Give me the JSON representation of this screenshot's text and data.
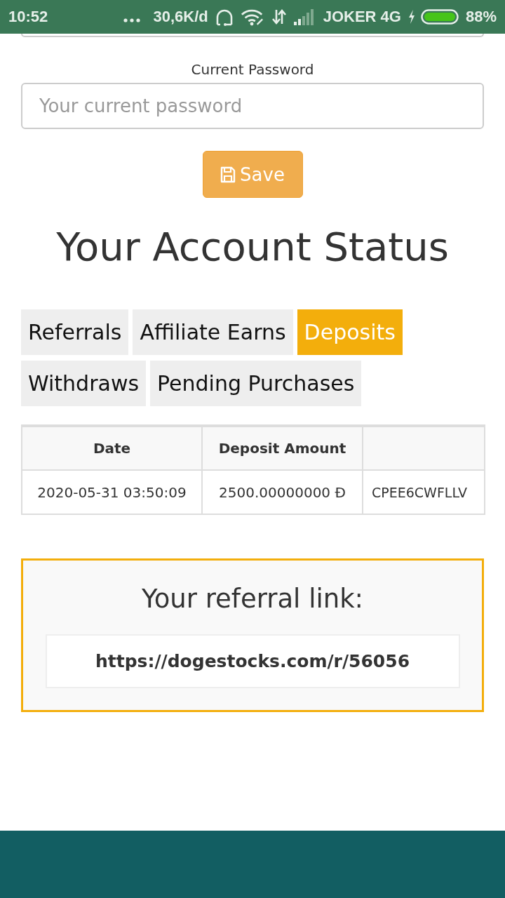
{
  "status_bar": {
    "time": "10:52",
    "speed": "30,6K/d",
    "carrier": "JOKER 4G",
    "battery": "88%"
  },
  "password_field": {
    "label": "Current Password",
    "placeholder": "Your current password"
  },
  "save_button": {
    "label": "Save"
  },
  "heading": "Your Account Status",
  "tabs": [
    {
      "label": "Referrals",
      "selected": false
    },
    {
      "label": "Affiliate Earns",
      "selected": false
    },
    {
      "label": "Deposits",
      "selected": true
    },
    {
      "label": "Withdraws",
      "selected": false
    },
    {
      "label": "Pending Purchases",
      "selected": false
    }
  ],
  "table": {
    "columns": [
      "Date",
      "Deposit Amount"
    ],
    "rows": [
      [
        "2020-05-31 03:50:09",
        "2500.00000000 Đ",
        "CPEE6CWFLLV"
      ]
    ]
  },
  "referral": {
    "title": "Your referral link:",
    "link": "https://dogestocks.com/r/56056"
  }
}
